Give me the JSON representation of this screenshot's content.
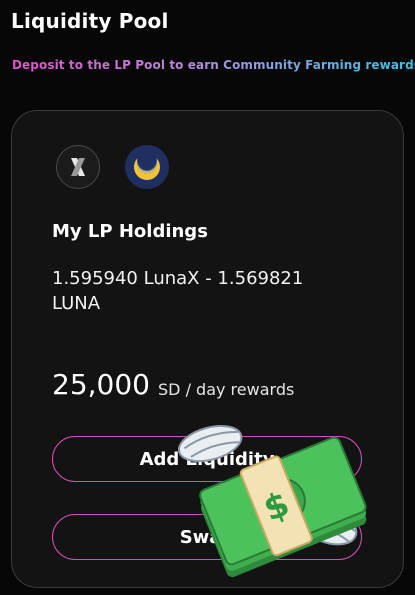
{
  "header": {
    "title": "Liquidity Pool",
    "subtitle": "Deposit to the LP Pool to earn Community Farming rewards"
  },
  "card": {
    "tokens": [
      {
        "name": "lunax-token-icon"
      },
      {
        "name": "luna-token-icon"
      }
    ],
    "holdings_title": "My LP Holdings",
    "holdings_value": "1.595940 LunaX - 1.569821 LUNA",
    "reward_amount": "25,000",
    "reward_label": "SD / day rewards",
    "add_liquidity_label": "Add Liquidity",
    "swap_label": "Swap"
  },
  "overlay": {
    "icon": "money-with-wings-icon"
  },
  "colors": {
    "background": "#070707",
    "card": "#131313",
    "button_border": "#d64fb8",
    "subtitle_gradient_start": "#e052c8",
    "subtitle_gradient_end": "#2fc7e8",
    "luna_token": "#1f2f62",
    "luna_moon": "#f4c430"
  }
}
